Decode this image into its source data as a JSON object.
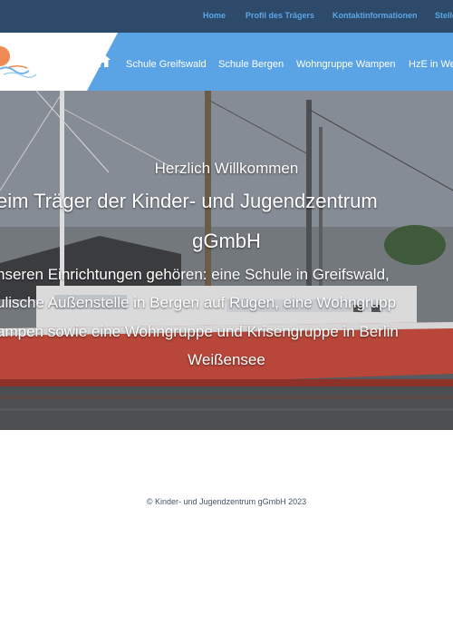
{
  "topbar": {
    "links": [
      "Home",
      "Profil des Trägers",
      "Kontaktinformationen",
      "Stelle"
    ]
  },
  "nav": {
    "home_icon": "home-icon",
    "items": [
      "Schule Greifswald",
      "Schule Bergen",
      "Wohngruppe Wampen",
      "HzE in Wei"
    ]
  },
  "hero": {
    "greeting": "Herzlich Willkommen",
    "heading_line1": "eim Träger der Kinder- und Jugendzentrum",
    "heading_line2": "gGmbH",
    "text_line1": "nseren Einrichtungen gehören: eine Schule in Greifswald,",
    "text_line2": "ulische Außenstelle in Bergen auf Rügen, eine Wohngrupp",
    "text_line3": "ampen sowie eine Wohngruppe und Krisengruppe in Berlin",
    "text_line4": "Weißensee"
  },
  "footer": {
    "copyright": "© Kinder- und Jugendzentrum gGmbH 2023"
  },
  "colors": {
    "topbar_bg": "#2e4a6b",
    "topbar_link": "#5aa6e8",
    "navbar_bg": "#5aa3e4",
    "hull_red": "#b8473a"
  }
}
